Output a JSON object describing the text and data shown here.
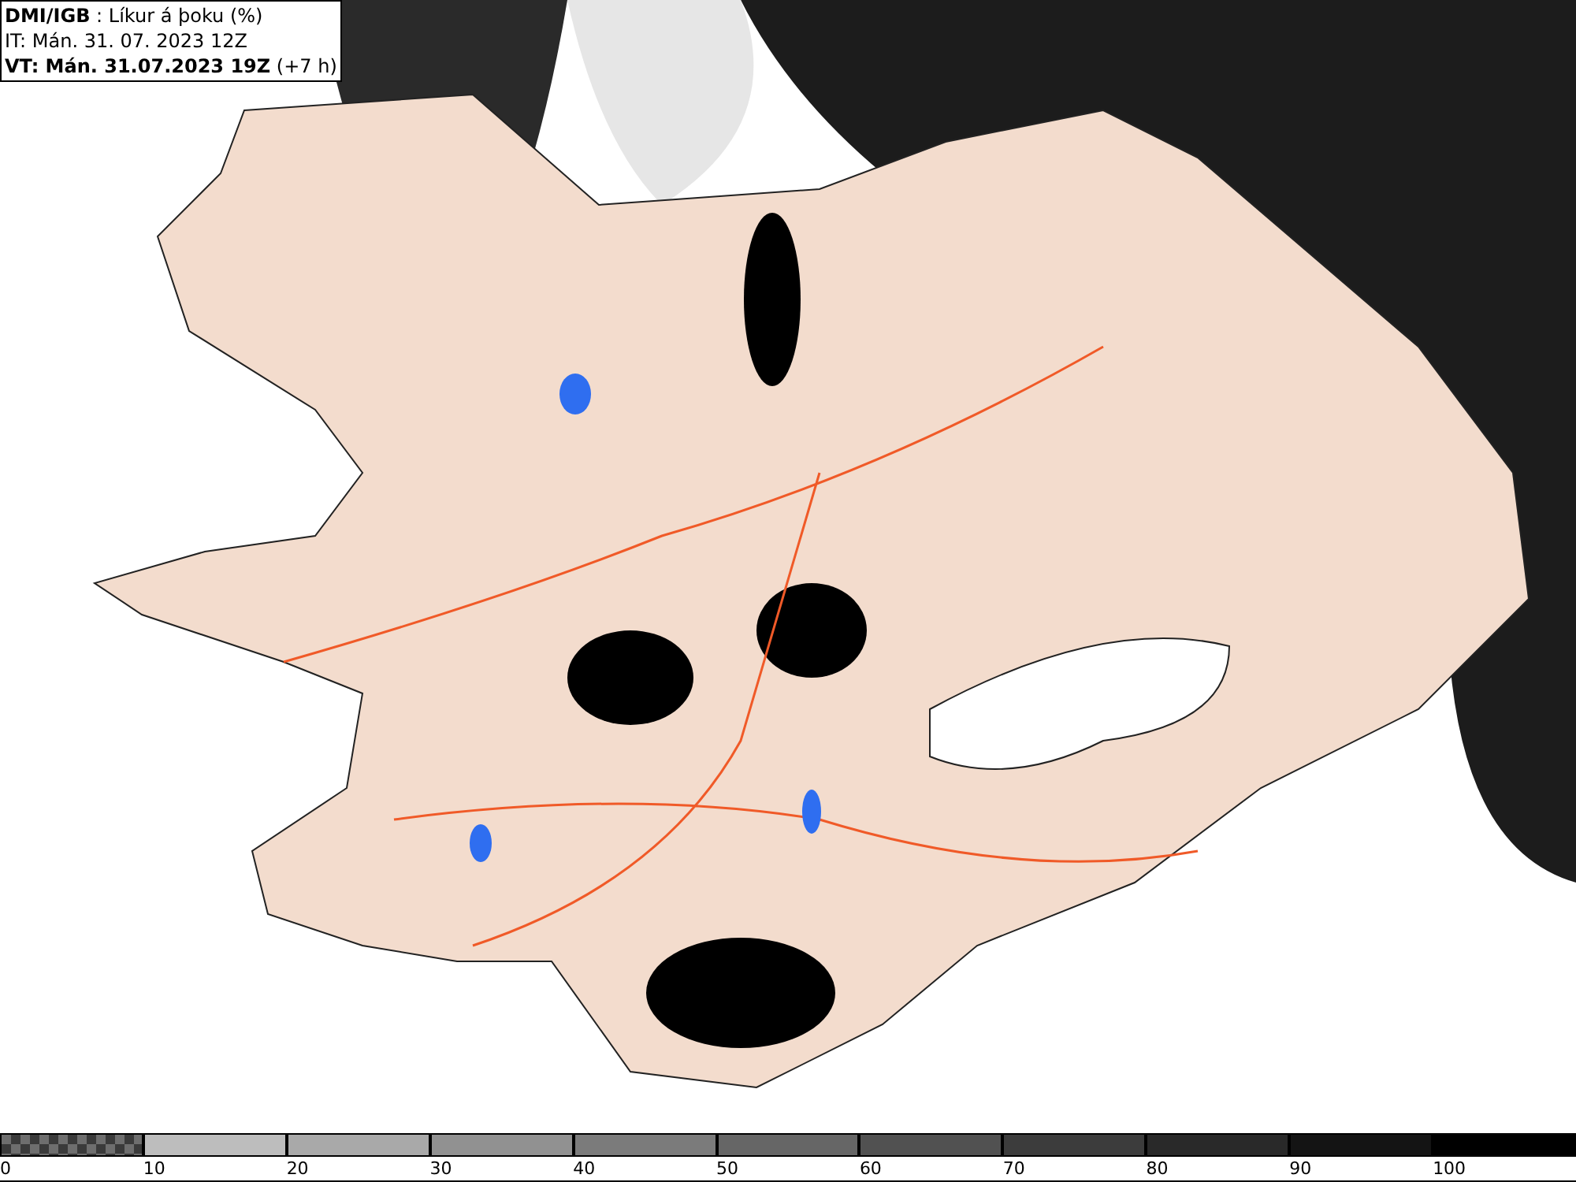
{
  "header": {
    "lines": [
      "**DMI/IGB** : Líkur á þoku (%)",
      "IT: Mán. 31. 07. 2023 12Z",
      "**VT: Mán. 31.07.2023 19Z** (+7 h)"
    ]
  },
  "legend": {
    "segments": [
      {
        "label": "0",
        "kind": "checker",
        "color": "#6e6e6e"
      },
      {
        "label": "10",
        "kind": "solid",
        "color": "#bdbdbd"
      },
      {
        "label": "20",
        "kind": "solid",
        "color": "#a9a9a9"
      },
      {
        "label": "30",
        "kind": "solid",
        "color": "#919191"
      },
      {
        "label": "40",
        "kind": "solid",
        "color": "#7b7b7b"
      },
      {
        "label": "50",
        "kind": "solid",
        "color": "#666666"
      },
      {
        "label": "60",
        "kind": "solid",
        "color": "#515151"
      },
      {
        "label": "70",
        "kind": "solid",
        "color": "#3c3c3c"
      },
      {
        "label": "80",
        "kind": "solid",
        "color": "#292929"
      },
      {
        "label": "90",
        "kind": "solid",
        "color": "#141414"
      },
      {
        "label": "100",
        "kind": "solid",
        "color": "#000000"
      }
    ]
  }
}
